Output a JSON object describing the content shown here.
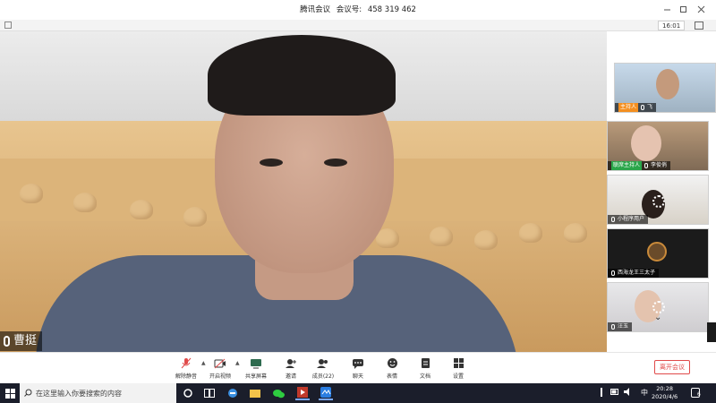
{
  "window": {
    "app_name": "腾讯会议",
    "meeting_id_label": "会议号:",
    "meeting_id": "458 319 462",
    "clock": "16:01"
  },
  "main_video": {
    "speaker_name": "曹挺"
  },
  "participants": [
    {
      "name": "飞",
      "role_tag": "主持人"
    },
    {
      "name": "李俊俏",
      "role_tag": "联席主持人"
    },
    {
      "name": "小程序用户",
      "role_tag": ""
    },
    {
      "name": "西海龙王三太子",
      "role_tag": ""
    },
    {
      "name": "汪玉",
      "role_tag": ""
    }
  ],
  "controls": {
    "mute": "解除静音",
    "video": "开启视频",
    "share": "共享屏幕",
    "invite": "邀请",
    "members": "成员(22)",
    "chat": "聊天",
    "reactions": "表情",
    "docs": "文档",
    "settings": "设置",
    "leave": "离开会议"
  },
  "taskbar": {
    "search_placeholder": "在这里输入你要搜索的内容",
    "ime": "中",
    "time": "20:28",
    "date": "2020/4/6",
    "notifications": "6"
  },
  "colors": {
    "leave_red": "#e04a4a",
    "host_tag": "#f48f20",
    "cohost_tag": "#2aa64a",
    "taskbar": "#1b1e2b"
  }
}
